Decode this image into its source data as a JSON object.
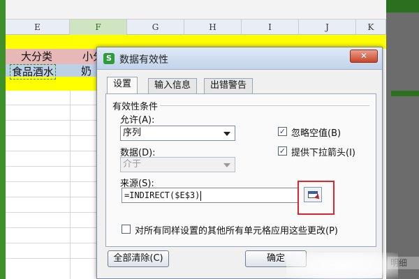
{
  "spreadsheet": {
    "columns": [
      "E",
      "F",
      "G",
      "H",
      "I",
      "J",
      "K"
    ],
    "selected_column": "F",
    "cells": {
      "header_major": "大分类",
      "header_minor_partial": "小分",
      "value_food": "食品酒水",
      "value_minor_partial": "奶"
    }
  },
  "dialog": {
    "title": "数据有效性",
    "close_symbol": "✕",
    "tabs": [
      "设置",
      "输入信息",
      "出错警告"
    ],
    "active_tab": "设置",
    "group_title": "有效性条件",
    "allow_label": "允许(A):",
    "allow_value": "序列",
    "data_label": "数据(D):",
    "data_value": "介于",
    "ignore_blank_label": "忽略空值(B)",
    "ignore_blank_checked": true,
    "dropdown_arrow_label": "提供下拉箭头(I)",
    "dropdown_arrow_checked": true,
    "source_label": "来源(S):",
    "source_value": "=INDIRECT($E$3)",
    "apply_all_label": "对所有同样设置的其他所有单元格应用这些更改(P)",
    "apply_all_checked": false,
    "clear_all_button": "全部清除(C)",
    "ok_button": "确定"
  },
  "side_label": "明细",
  "colors": {
    "frame_green": "#3f8f2a",
    "highlight_yellow": "#ffff00",
    "annotation_red": "#e0252a"
  }
}
